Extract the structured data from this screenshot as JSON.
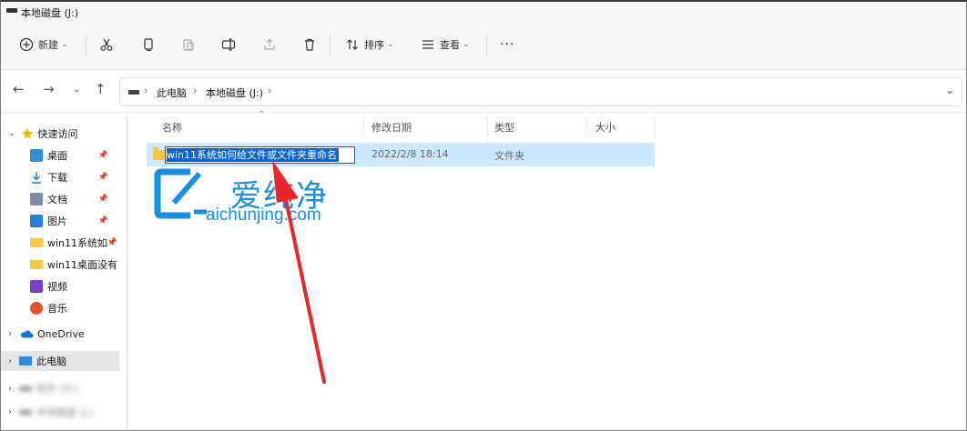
{
  "window": {
    "title": "本地磁盘 (J:)"
  },
  "toolbar": {
    "new_label": "新建",
    "sort_label": "排序",
    "view_label": "查看",
    "more_label": "···"
  },
  "address": {
    "crumbs": [
      "此电脑",
      "本地磁盘 (J:)"
    ]
  },
  "sidebar": {
    "quick_access": "快速访问",
    "items": [
      {
        "label": "桌面"
      },
      {
        "label": "下载"
      },
      {
        "label": "文档"
      },
      {
        "label": "图片"
      },
      {
        "label": "win11系统如"
      },
      {
        "label": "win11桌面没有"
      },
      {
        "label": "视频"
      },
      {
        "label": "音乐"
      }
    ],
    "onedrive": "OneDrive",
    "this_pc": "此电脑",
    "blurred_1": "软件 (H:)",
    "blurred_2": "本地磁盘 (J:)"
  },
  "columns": {
    "name": "名称",
    "modified": "修改日期",
    "type": "类型",
    "size": "大小"
  },
  "file": {
    "rename_value": "win11系统如何给文件或文件夹重命名",
    "modified": "2022/2/8 18:14",
    "type": "文件夹"
  },
  "watermark": {
    "text": "爱纯净",
    "url": "aichunjing.com"
  },
  "colors": {
    "selection": "#cce8ff",
    "rename_highlight": "#0a64d6",
    "arrow": "#e8262b",
    "watermark": "#1a8fe0"
  }
}
